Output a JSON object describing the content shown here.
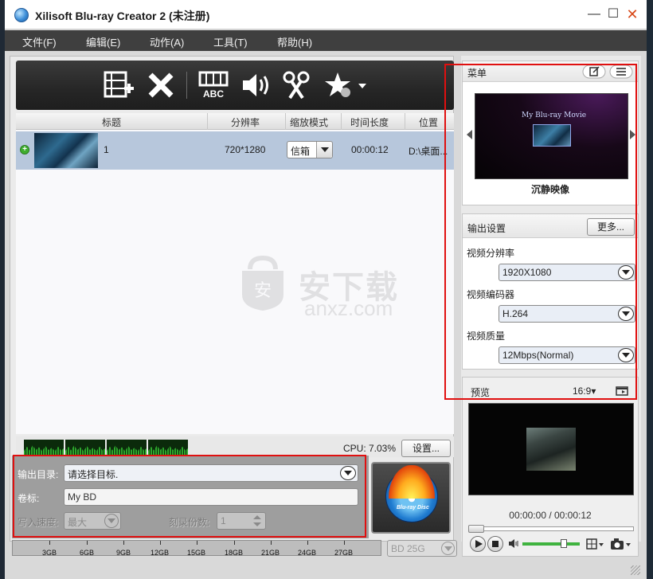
{
  "window": {
    "title": "Xilisoft Blu-ray Creator 2 (未注册)",
    "controls": [
      "minimize-icon",
      "maximize-icon",
      "close-icon"
    ]
  },
  "menubar": {
    "items": [
      "文件(F)",
      "编辑(E)",
      "动作(A)",
      "工具(T)",
      "帮助(H)"
    ]
  },
  "toolbar": {
    "buttons": [
      "add-file-icon",
      "delete-icon",
      "subtitle-icon",
      "audio-icon",
      "clip-icon",
      "effects-icon"
    ]
  },
  "file_list": {
    "columns": [
      "标题",
      "分辨率",
      "缩放模式",
      "时间长度",
      "位置"
    ],
    "rows": [
      {
        "title": "1",
        "resolution": "720*1280",
        "zoom_mode": "信箱",
        "duration": "00:00:12",
        "location": "D:\\桌面..."
      }
    ]
  },
  "watermark": {
    "brand": "安下载",
    "url": "anxz.com"
  },
  "status": {
    "cpu": "CPU: 7.03%",
    "settings_button": "设置..."
  },
  "output": {
    "dest_label": "输出目录:",
    "dest_value": "请选择目标.",
    "volume_label": "卷标:",
    "volume_value": "My BD",
    "speed_label": "写入速度:",
    "speed_value": "最大",
    "copies_label": "刻录份数:",
    "copies_value": "1",
    "burn_logo": "Blu-ray Disc"
  },
  "capacity": {
    "ticks": [
      "3GB",
      "6GB",
      "9GB",
      "12GB",
      "15GB",
      "18GB",
      "21GB",
      "24GB",
      "27GB"
    ],
    "disc_type": "BD 25G"
  },
  "menu_panel": {
    "title": "菜单",
    "preview_title": "My Blu-ray Movie",
    "menu_name": "沉静映像"
  },
  "output_settings": {
    "title": "输出设置",
    "more_button": "更多...",
    "resolution_label": "视频分辨率",
    "resolution_value": "1920X1080",
    "codec_label": "视频编码器",
    "codec_value": "H.264",
    "quality_label": "视频质量",
    "quality_value": "12Mbps(Normal)"
  },
  "preview": {
    "title": "预览",
    "aspect": "16:9▾",
    "time": "00:00:00 / 00:00:12"
  },
  "colors": {
    "highlight": "#e01010",
    "selected_row": "#b7c7dc",
    "volume": "#3fb33f"
  }
}
